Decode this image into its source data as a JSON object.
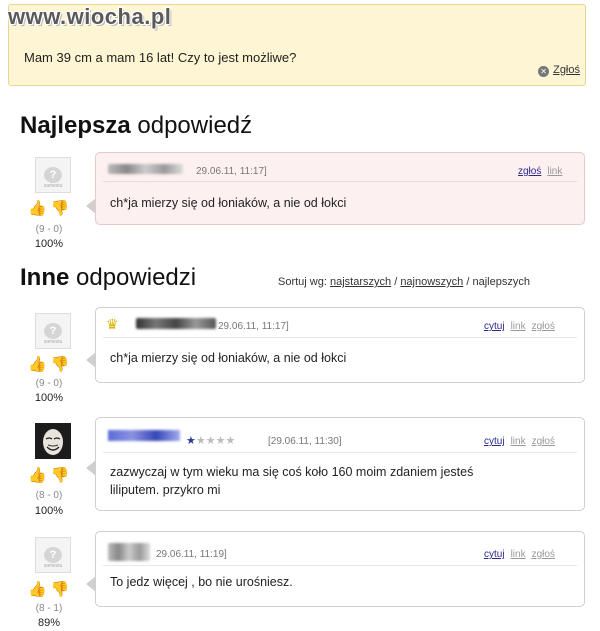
{
  "site_logo": "www.wiocha.pl",
  "question": {
    "text": "Mam 39 cm a mam 16 lat! Czy to jest możliwe?",
    "report": "Zgłoś"
  },
  "best_answer": {
    "title_bold": "Najlepsza",
    "title_rest": " odpowiedź",
    "date": "29.06.11, 11:17]",
    "links": {
      "report": "zgłoś",
      "link": "link"
    },
    "text": "ch*ja mierzy się od łoniaków, a nie od łokci",
    "score": "(9 - 0)",
    "percent": "100%"
  },
  "other_answers": {
    "title_bold": "Inne",
    "title_rest": " odpowiedzi",
    "sort_label": "Sortuj wg:",
    "sort_oldest": "najstarszych",
    "sort_newest": "najnowszych",
    "sort_best": "najlepszych",
    "separator": "/"
  },
  "answers": [
    {
      "date": "29.06.11, 11:17]",
      "links": {
        "quote": "cytuj",
        "link": "link",
        "report": "zgłoś"
      },
      "text": "ch*ja mierzy się od łoniaków, a nie od łokci",
      "score": "(9 - 0)",
      "percent": "100%"
    },
    {
      "date": "[29.06.11, 11:30]",
      "stars": "★★★★★",
      "links": {
        "quote": "cytuj",
        "link": "link",
        "report": "zgłoś"
      },
      "text_line1": "zazwyczaj w tym wieku ma się coś koło 160 moim zdaniem jesteś",
      "text_line2": "liliputem. przykro mi",
      "score": "(8 - 0)",
      "percent": "100%"
    },
    {
      "date": "29.06.11, 11:19]",
      "links": {
        "quote": "cytuj",
        "link": "link",
        "report": "zgłoś"
      },
      "text": "To jedz więcej , bo nie urośniesz.",
      "score": "(8 - 1)",
      "percent": "89%"
    }
  ],
  "avatar_label": "?",
  "avatar_caption": "samesiu",
  "icons": {
    "thumb_up": "👍",
    "thumb_down": "👎",
    "crown": "♛",
    "report_x": "✕"
  },
  "colors": {
    "question_bg": "#fdf5d3",
    "best_answer_bg": "#fdf0f0",
    "link_blue": "#2a2a88"
  }
}
